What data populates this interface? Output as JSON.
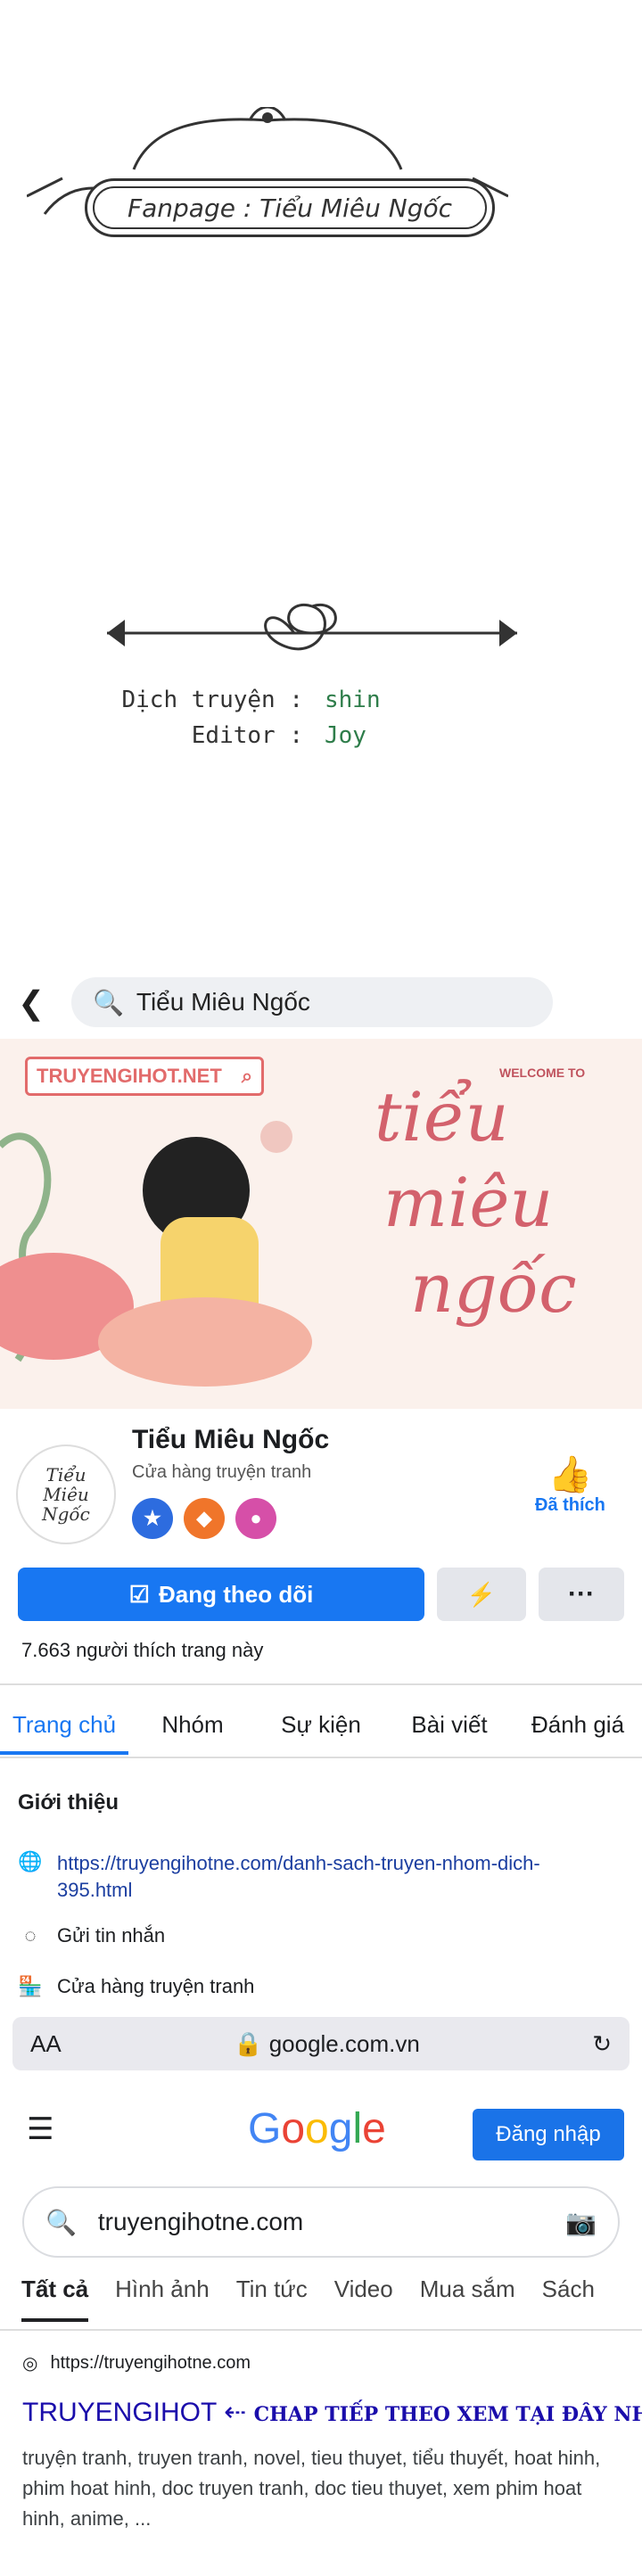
{
  "ornament": {
    "fanpage_text": "Fanpage : Tiểu Miêu Ngốc",
    "credits": [
      {
        "label": "Dịch truyện :",
        "value": "shin"
      },
      {
        "label": "Editor :",
        "value": "Joy"
      }
    ]
  },
  "facebook": {
    "search_value": "Tiểu Miêu Ngốc",
    "cover": {
      "site_label": "TRUYENGIHOT.NET",
      "welcome": "WELCOME TO",
      "title_lines": [
        "tiểu",
        "miêu",
        "ngốc"
      ]
    },
    "page_name": "Tiểu Miêu Ngốc",
    "category": "Cửa hàng truyện tranh",
    "liked_label": "Đã thích",
    "follow_label": "Đang theo dõi",
    "more_label": "···",
    "likes_count": "7.663 người thích trang này",
    "tabs": [
      "Trang chủ",
      "Nhóm",
      "Sự kiện",
      "Bài viết",
      "Đánh giá"
    ],
    "intro_title": "Giới thiệu",
    "info": [
      {
        "icon": "globe-icon",
        "text": "https://truyengihotne.com/danh-sach-truyen-nhom-dich-395.html"
      },
      {
        "icon": "messenger-icon",
        "text": "Gửi tin nhắn"
      },
      {
        "icon": "shop-icon",
        "text": "Cửa hàng truyện tranh"
      }
    ]
  },
  "safari": {
    "text_size": "AA",
    "address": "google.com.vn"
  },
  "google": {
    "logo": "Google",
    "signin_label": "Đăng nhập",
    "search_value": "truyengihotne.com",
    "tabs": [
      "Tất cả",
      "Hình ảnh",
      "Tin tức",
      "Video",
      "Mua sắm",
      "Sách"
    ],
    "result": {
      "url": "https://truyengihotne.com",
      "title": "TRUYENGIHOT",
      "arrow": "⇠",
      "cta": "CHAP TIẾP THEO XEM TẠI ĐÂY NHA",
      "description": "truyện tranh, truyen tranh, novel, tieu thuyet, tiểu thuyết, hoat hinh, phim hoat hinh, doc truyen tranh, doc tieu thuyet, xem phim hoat hinh, anime, ..."
    }
  },
  "colors": {
    "fb_blue": "#1877f2",
    "link_blue": "#1a0dab",
    "credit_green": "#2e7d4a"
  }
}
